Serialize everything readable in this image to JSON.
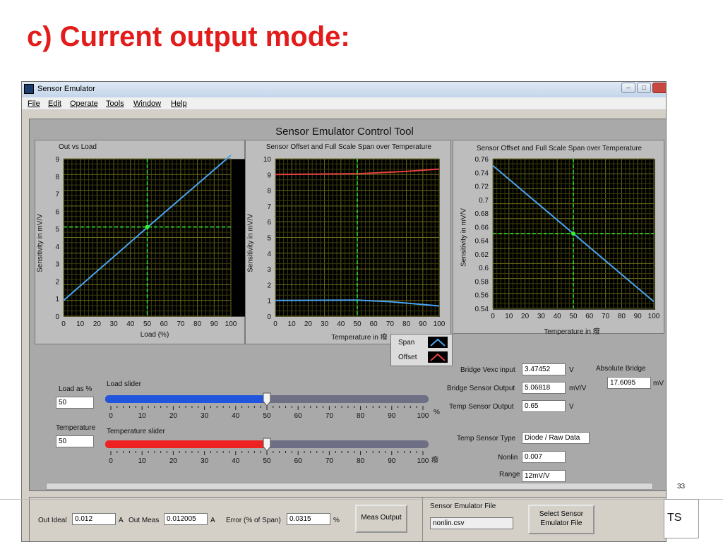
{
  "slide": {
    "title": "c) Current output mode:",
    "page_number": "33",
    "footer_text": "TS"
  },
  "window": {
    "title": "Sensor Emulator",
    "buttons": [
      "–",
      "□"
    ]
  },
  "menu": [
    "File",
    "Edit",
    "Operate",
    "Tools",
    "Window",
    "Help"
  ],
  "tool_title": "Sensor Emulator Control Tool",
  "chart_data": [
    {
      "type": "line",
      "title": "Out vs Load",
      "xlabel": "Load (%)",
      "ylabel": "Sensitivity in mV/V",
      "xlim": [
        0,
        100
      ],
      "ylim": [
        0,
        9
      ],
      "xticks": [
        "0",
        "10",
        "20",
        "30",
        "40",
        "50",
        "60",
        "70",
        "80",
        "90",
        "100"
      ],
      "yticks": [
        "0",
        "1",
        "2",
        "3",
        "4",
        "5",
        "6",
        "7",
        "8",
        "9"
      ],
      "cursor": {
        "x": 50,
        "y": 5.1
      },
      "series": [
        {
          "color": "#4aa3f0",
          "x": [
            0,
            50,
            100
          ],
          "y": [
            0.9,
            5.07,
            9.2
          ]
        }
      ]
    },
    {
      "type": "line",
      "title": "Sensor Offset and Full Scale Span over Temperature",
      "xlabel": "Temperature in 癈",
      "ylabel": "Sensitivity in mV/V",
      "xlim": [
        0,
        100
      ],
      "ylim": [
        0,
        10
      ],
      "xticks": [
        "0",
        "10",
        "20",
        "30",
        "40",
        "50",
        "60",
        "70",
        "80",
        "90",
        "100"
      ],
      "yticks": [
        "0",
        "1",
        "2",
        "3",
        "4",
        "5",
        "6",
        "7",
        "8",
        "9",
        "10"
      ],
      "cursor": {
        "x": 50,
        "y": null
      },
      "series": [
        {
          "name": "Span",
          "color": "#4aa3f0",
          "x": [
            0,
            50,
            70,
            100
          ],
          "y": [
            1.0,
            1.02,
            0.92,
            0.65
          ]
        },
        {
          "name": "Offset",
          "color": "#e84040",
          "x": [
            0,
            50,
            80,
            100
          ],
          "y": [
            9.0,
            9.05,
            9.2,
            9.35
          ]
        }
      ]
    },
    {
      "type": "line",
      "title": "Sensor Offset and Full Scale Span over Temperature",
      "xlabel": "Temperature in 癈",
      "ylabel": "Sensitivity in mV/V",
      "xlim": [
        0,
        100
      ],
      "ylim": [
        0.54,
        0.76
      ],
      "xticks": [
        "0",
        "10",
        "20",
        "30",
        "40",
        "50",
        "60",
        "70",
        "80",
        "90",
        "100"
      ],
      "yticks": [
        "0.54",
        "0.56",
        "0.58",
        "0.6",
        "0.62",
        "0.64",
        "0.66",
        "0.68",
        "0.7",
        "0.72",
        "0.74",
        "0.76"
      ],
      "cursor": {
        "x": 50,
        "y": 0.65
      },
      "series": [
        {
          "color": "#4aa3f0",
          "x": [
            0,
            100
          ],
          "y": [
            0.75,
            0.55
          ]
        }
      ]
    }
  ],
  "legend": [
    {
      "label": "Span",
      "color": "#4aa3f0"
    },
    {
      "label": "Offset",
      "color": "#e84040"
    }
  ],
  "controls": {
    "load_pct_label": "Load as %",
    "load_pct_value": "50",
    "load_slider_label": "Load slider",
    "load_slider_value": 50,
    "load_slider_color": "#2255dd",
    "temp_label": "Temperature",
    "temp_value": "50",
    "temp_slider_label": "Temperature slider",
    "temp_slider_value": 50,
    "temp_slider_color": "#ee2222",
    "slider_ticks": [
      "0",
      "10",
      "20",
      "30",
      "40",
      "50",
      "60",
      "70",
      "80",
      "90",
      "100"
    ],
    "load_unit": "%",
    "temp_unit": "癈"
  },
  "readouts": {
    "vexc_label": "Bridge Vexc input",
    "vexc_value": "3.47452",
    "vexc_unit": "V",
    "abs_bridge_label": "Absolute Bridge",
    "abs_bridge_value": "17.6095",
    "abs_bridge_unit": "mV",
    "bridge_out_label": "Bridge Sensor Output",
    "bridge_out_value": "5.06818",
    "bridge_out_unit": "mV/V",
    "temp_out_label": "Temp Sensor Output",
    "temp_out_value": "0.65",
    "temp_out_unit": "V",
    "temp_type_label": "Temp Sensor Type",
    "temp_type_value": "Diode / Raw Data",
    "nonlin_label": "Nonlin",
    "nonlin_value": "0.007",
    "range_label": "Range",
    "range_value": "12mV/V"
  },
  "bottom": {
    "out_ideal_label": "Out Ideal",
    "out_ideal_value": "0.012",
    "out_ideal_unit": "A",
    "out_meas_label": "Out Meas",
    "out_meas_value": "0.012005",
    "out_meas_unit": "A",
    "error_label": "Error (% of Span)",
    "error_value": "0.0315",
    "error_unit": "%",
    "meas_button": "Meas Output",
    "file_label": "Sensor Emulator File",
    "file_value": "nonlin.csv",
    "select_button": "Select Sensor Emulator File"
  }
}
